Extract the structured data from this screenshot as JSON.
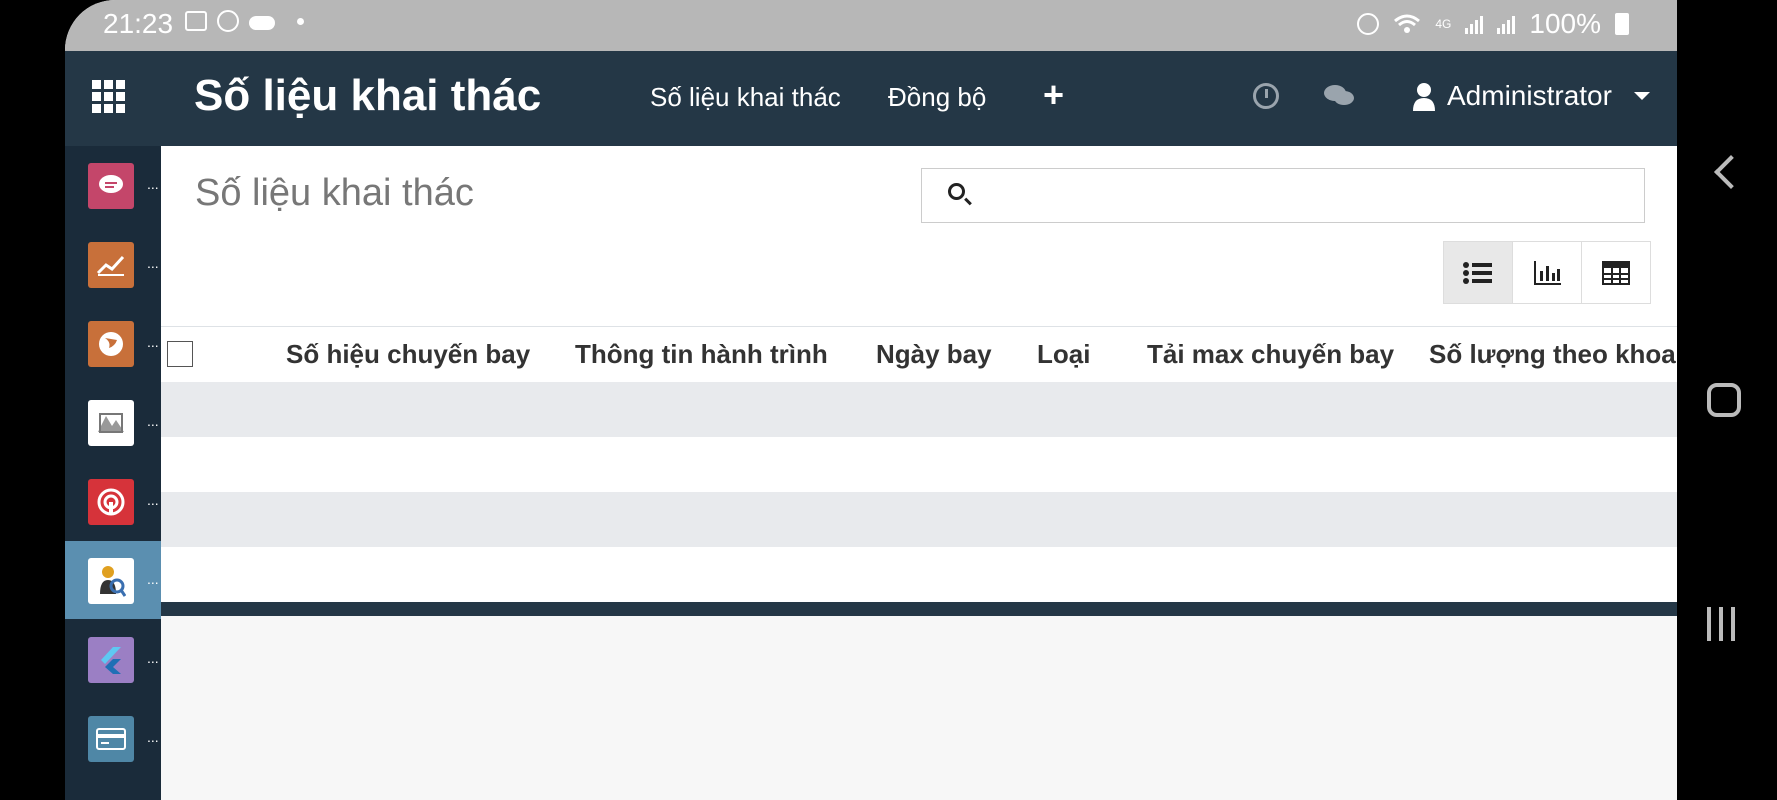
{
  "status_bar": {
    "time": "21:23",
    "battery": "100%",
    "network": "4G"
  },
  "topnav": {
    "app_title": "Số liệu khai thác",
    "menu": [
      "Số liệu khai thác",
      "Đồng bộ"
    ],
    "plus": "+",
    "user": "Administrator"
  },
  "sidebar": {
    "items": [
      {
        "icon": "chat-bubble-icon",
        "color": "#c4466a",
        "active": false
      },
      {
        "icon": "trend-chart-icon",
        "color": "#c8703a",
        "active": false
      },
      {
        "icon": "globe-icon",
        "color": "#c8703a",
        "active": false
      },
      {
        "icon": "map-icon",
        "color": "#ffffff",
        "active": false
      },
      {
        "icon": "broadcast-icon",
        "color": "#d6333a",
        "active": false
      },
      {
        "icon": "search-person-icon",
        "color": "#ffffff",
        "active": true
      },
      {
        "icon": "flutter-icon",
        "color": "#9b7fc4",
        "active": false
      },
      {
        "icon": "card-icon",
        "color": "#4f87a6",
        "active": false
      }
    ],
    "dots": "..."
  },
  "control_panel": {
    "breadcrumb": "Số liệu khai thác",
    "search_placeholder": "",
    "views": [
      "list-view-icon",
      "graph-view-icon",
      "pivot-view-icon"
    ]
  },
  "table": {
    "columns": [
      "Số hiệu chuyến bay",
      "Thông tin hành trình",
      "Ngày bay",
      "Loại",
      "Tải max chuyến bay",
      "Số lượng theo khoang"
    ],
    "rows": 4
  },
  "colors": {
    "navbar": "#243746",
    "active_sidebar": "#5b8fb0",
    "stripe": "#e8eaed"
  }
}
